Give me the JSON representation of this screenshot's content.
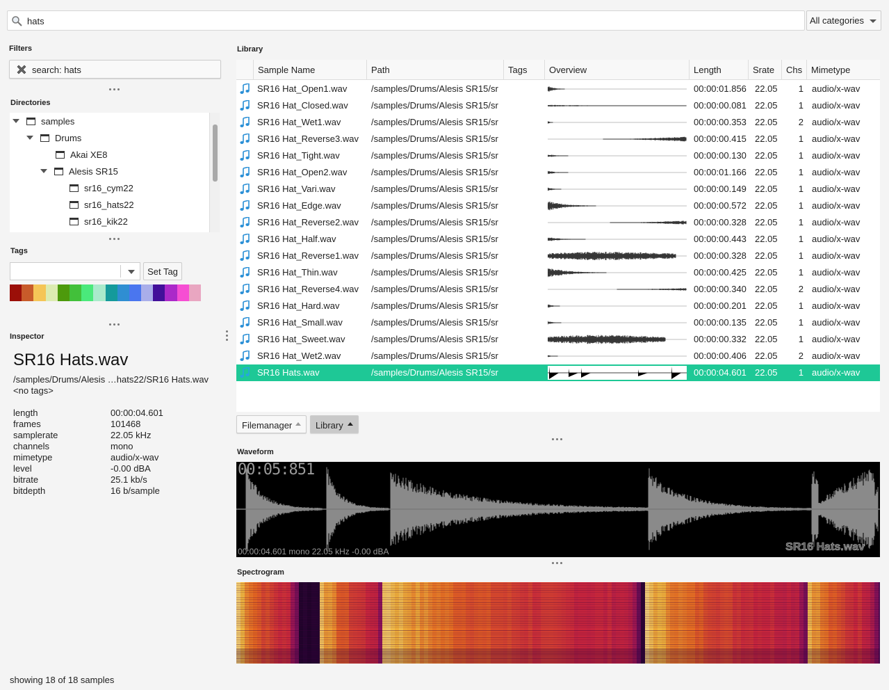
{
  "search": {
    "value": "hats",
    "category": "All categories"
  },
  "filters": {
    "title": "Filters",
    "chip": "search: hats"
  },
  "directories": {
    "title": "Directories",
    "items": [
      {
        "label": "samples",
        "expanded": true,
        "level": 0
      },
      {
        "label": "Drums",
        "expanded": true,
        "level": 1
      },
      {
        "label": "Akai XE8",
        "expanded": false,
        "level": 2
      },
      {
        "label": "Alesis SR15",
        "expanded": true,
        "level": 2
      },
      {
        "label": "sr16_cym22",
        "expanded": false,
        "level": 3
      },
      {
        "label": "sr16_hats22",
        "expanded": false,
        "level": 3
      },
      {
        "label": "sr16_kik22",
        "expanded": false,
        "level": 3
      }
    ]
  },
  "tags": {
    "title": "Tags",
    "input_value": "",
    "set_tag_label": "Set Tag",
    "swatches": [
      "#9b0f08",
      "#c85b2a",
      "#f5c557",
      "#dcebb1",
      "#4d9a0c",
      "#42c03a",
      "#4ae97b",
      "#a9eacb",
      "#149a9b",
      "#2f8ed2",
      "#4a76ef",
      "#a9aeea",
      "#42109a",
      "#ab29c9",
      "#f64ed3",
      "#e9a6c1"
    ]
  },
  "inspector": {
    "title": "Inspector",
    "name": "SR16 Hats.wav",
    "path": "/samples/Drums/Alesis …hats22/SR16 Hats.wav",
    "tags": "<no tags>",
    "props": [
      {
        "k": "length",
        "v": "00:00:04.601"
      },
      {
        "k": "frames",
        "v": "101468"
      },
      {
        "k": "samplerate",
        "v": "22.05 kHz"
      },
      {
        "k": "channels",
        "v": "mono"
      },
      {
        "k": "mimetype",
        "v": "audio/x-wav"
      },
      {
        "k": "level",
        "v": "-0.00 dBA"
      },
      {
        "k": "bitrate",
        "v": "25.1 kb/s"
      },
      {
        "k": "bitdepth",
        "v": "16 b/sample"
      }
    ]
  },
  "library": {
    "title": "Library",
    "columns": [
      "Sample Name",
      "Path",
      "Tags",
      "Overview",
      "Length",
      "Srate",
      "Chs",
      "Mimetype"
    ],
    "rows": [
      {
        "name": "SR16 Hat_Open1.wav",
        "path": "/samples/Drums/Alesis SR15/sr",
        "tags": "",
        "length": "00:00:01.856",
        "srate": "22.05",
        "chs": "1",
        "mime": "audio/x-wav"
      },
      {
        "name": "SR16 Hat_Closed.wav",
        "path": "/samples/Drums/Alesis SR15/sr",
        "tags": "",
        "length": "00:00:00.081",
        "srate": "22.05",
        "chs": "1",
        "mime": "audio/x-wav"
      },
      {
        "name": "SR16 Hat_Wet1.wav",
        "path": "/samples/Drums/Alesis SR15/sr",
        "tags": "",
        "length": "00:00:00.353",
        "srate": "22.05",
        "chs": "2",
        "mime": "audio/x-wav"
      },
      {
        "name": "SR16 Hat_Reverse3.wav",
        "path": "/samples/Drums/Alesis SR15/sr",
        "tags": "",
        "length": "00:00:00.415",
        "srate": "22.05",
        "chs": "1",
        "mime": "audio/x-wav"
      },
      {
        "name": "SR16 Hat_Tight.wav",
        "path": "/samples/Drums/Alesis SR15/sr",
        "tags": "",
        "length": "00:00:00.130",
        "srate": "22.05",
        "chs": "1",
        "mime": "audio/x-wav"
      },
      {
        "name": "SR16 Hat_Open2.wav",
        "path": "/samples/Drums/Alesis SR15/sr",
        "tags": "",
        "length": "00:00:01.166",
        "srate": "22.05",
        "chs": "1",
        "mime": "audio/x-wav"
      },
      {
        "name": "SR16 Hat_Vari.wav",
        "path": "/samples/Drums/Alesis SR15/sr",
        "tags": "",
        "length": "00:00:00.149",
        "srate": "22.05",
        "chs": "1",
        "mime": "audio/x-wav"
      },
      {
        "name": "SR16 Hat_Edge.wav",
        "path": "/samples/Drums/Alesis SR15/sr",
        "tags": "",
        "length": "00:00:00.572",
        "srate": "22.05",
        "chs": "1",
        "mime": "audio/x-wav"
      },
      {
        "name": "SR16 Hat_Reverse2.wav",
        "path": "/samples/Drums/Alesis SR15/sr",
        "tags": "",
        "length": "00:00:00.328",
        "srate": "22.05",
        "chs": "1",
        "mime": "audio/x-wav"
      },
      {
        "name": "SR16 Hat_Half.wav",
        "path": "/samples/Drums/Alesis SR15/sr",
        "tags": "",
        "length": "00:00:00.443",
        "srate": "22.05",
        "chs": "1",
        "mime": "audio/x-wav"
      },
      {
        "name": "SR16 Hat_Reverse1.wav",
        "path": "/samples/Drums/Alesis SR15/sr",
        "tags": "",
        "length": "00:00:00.328",
        "srate": "22.05",
        "chs": "1",
        "mime": "audio/x-wav"
      },
      {
        "name": "SR16 Hat_Thin.wav",
        "path": "/samples/Drums/Alesis SR15/sr",
        "tags": "",
        "length": "00:00:00.425",
        "srate": "22.05",
        "chs": "1",
        "mime": "audio/x-wav"
      },
      {
        "name": "SR16 Hat_Reverse4.wav",
        "path": "/samples/Drums/Alesis SR15/sr",
        "tags": "",
        "length": "00:00:00.340",
        "srate": "22.05",
        "chs": "2",
        "mime": "audio/x-wav"
      },
      {
        "name": "SR16 Hat_Hard.wav",
        "path": "/samples/Drums/Alesis SR15/sr",
        "tags": "",
        "length": "00:00:00.201",
        "srate": "22.05",
        "chs": "1",
        "mime": "audio/x-wav"
      },
      {
        "name": "SR16 Hat_Small.wav",
        "path": "/samples/Drums/Alesis SR15/sr",
        "tags": "",
        "length": "00:00:00.135",
        "srate": "22.05",
        "chs": "1",
        "mime": "audio/x-wav"
      },
      {
        "name": "SR16 Hat_Sweet.wav",
        "path": "/samples/Drums/Alesis SR15/sr",
        "tags": "",
        "length": "00:00:00.332",
        "srate": "22.05",
        "chs": "1",
        "mime": "audio/x-wav"
      },
      {
        "name": "SR16 Hat_Wet2.wav",
        "path": "/samples/Drums/Alesis SR15/sr",
        "tags": "",
        "length": "00:00:00.406",
        "srate": "22.05",
        "chs": "2",
        "mime": "audio/x-wav"
      },
      {
        "name": "SR16 Hats.wav",
        "path": "/samples/Drums/Alesis SR15/sr",
        "tags": "",
        "length": "00:00:04.601",
        "srate": "22.05",
        "chs": "1",
        "mime": "audio/x-wav",
        "selected": true
      }
    ]
  },
  "tabs": [
    {
      "label": "Filemanager",
      "active": false
    },
    {
      "label": "Library",
      "active": true
    }
  ],
  "waveform": {
    "title": "Waveform",
    "timecode": "00:05:851",
    "info": "00:00:04.601  mono  22.05 kHz  -0.00 dBA",
    "name": "SR16 Hats.wav"
  },
  "spectrogram": {
    "title": "Spectrogram"
  },
  "status": "showing 18 of 18 samples",
  "colors": {
    "selection": "#1ec896",
    "panel_bg": "#f4f4f4",
    "waveform_bg": "#000000",
    "waveform_fg": "#8a8a8a"
  }
}
